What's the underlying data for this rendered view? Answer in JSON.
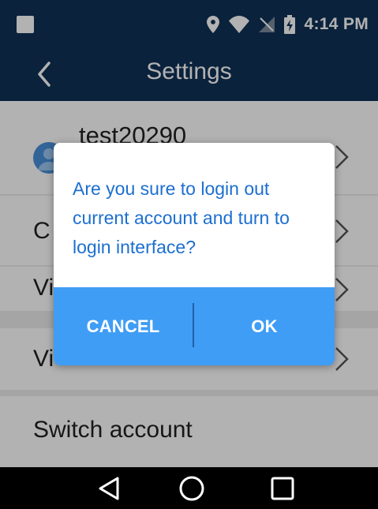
{
  "status_bar": {
    "time": "4:14 PM",
    "icons": [
      "notification-square-icon",
      "location-icon",
      "wifi-icon",
      "no-sim-icon",
      "battery-charging-icon"
    ]
  },
  "app_bar": {
    "title": "Settings",
    "back_icon": "chevron-left-icon"
  },
  "settings": {
    "account_name": "test20290",
    "rows": [
      {
        "label": "C",
        "visible_fragment": true
      },
      {
        "label": "Vi",
        "visible_fragment": true
      },
      {
        "label": "Vi",
        "visible_fragment": true
      }
    ],
    "switch_account": "Switch account"
  },
  "dialog": {
    "message": "Are you sure to login out current account and turn to login interface?",
    "cancel_label": "CANCEL",
    "ok_label": "OK"
  },
  "nav_bar": {
    "icons": [
      "back-triangle-icon",
      "home-circle-icon",
      "recents-square-icon"
    ]
  },
  "colors": {
    "primary_dark": "#0f3256",
    "dialog_accent": "#3f9df5",
    "dialog_text": "#1c6fd0"
  }
}
